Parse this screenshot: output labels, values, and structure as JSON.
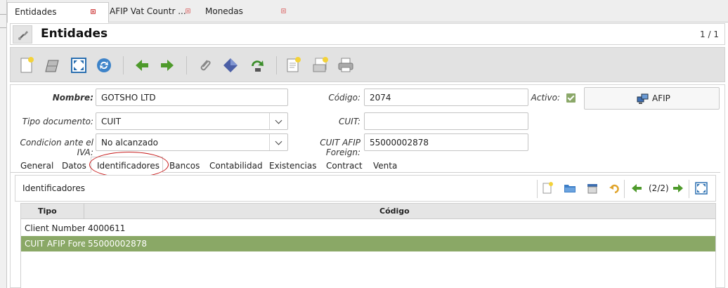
{
  "tabs": [
    {
      "label": "Entidades",
      "active": true
    },
    {
      "label": "AFIP Vat Countr ...",
      "active": false
    },
    {
      "label": "Monedas",
      "active": false
    }
  ],
  "header": {
    "title": "Entidades",
    "record_count": "1 / 1",
    "icon": "settings-tool-icon"
  },
  "toolbar": {
    "buttons": [
      "new-record-icon",
      "copy-record-icon",
      "fullscreen-icon",
      "refresh-icon",
      "back-arrow-icon",
      "forward-arrow-icon",
      "attachment-icon",
      "zoom-icon",
      "process-icon",
      "report-icon",
      "archive-icon",
      "print-icon"
    ]
  },
  "form": {
    "nombre": {
      "label": "Nombre:",
      "value": "GOTSHO LTD"
    },
    "codigo": {
      "label": "Código:",
      "value": "2074"
    },
    "activo": {
      "label": "Activo:",
      "checked": true
    },
    "afip_button": {
      "label": "AFIP",
      "icon": "network-computers-icon"
    },
    "tipo_documento": {
      "label": "Tipo documento:",
      "value": "CUIT"
    },
    "cuit": {
      "label": "CUIT:",
      "value": ""
    },
    "condicion_iva": {
      "label": "Condicion ante el IVA:",
      "value": "No alcanzado"
    },
    "cuit_afip_foreign": {
      "label": "CUIT AFIP Foreign:",
      "value": "55000002878"
    }
  },
  "subtabs": [
    "General",
    "Datos",
    "Identificadores",
    "Bancos",
    "Contabilidad",
    "Existencias",
    "Contract",
    "Venta"
  ],
  "active_subtab": "Identificadores",
  "panel": {
    "title": "Identificadores",
    "nav_text": "(2/2)"
  },
  "grid": {
    "columns": [
      "Tipo",
      "Código"
    ],
    "rows": [
      {
        "tipo": "Client Number",
        "codigo": "4000611",
        "selected": false
      },
      {
        "tipo": "CUIT AFIP Forei",
        "codigo": "55000002878",
        "selected": true
      }
    ]
  },
  "colors": {
    "selected_row": "#8aa866",
    "checkbox": "#8ba869",
    "highlight_ellipse": "#c71a1a",
    "nav_arrow": "#4e9a2b"
  }
}
